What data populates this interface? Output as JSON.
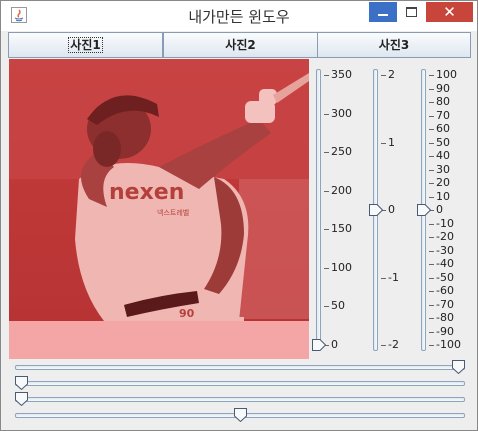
{
  "window": {
    "title": "내가만든 윈도우",
    "close_glyph": "✕"
  },
  "tabs": [
    {
      "label": "사진1",
      "selected": true
    },
    {
      "label": "사진2",
      "selected": false
    },
    {
      "label": "사진3",
      "selected": false
    }
  ],
  "photo": {
    "description": "batter mid-swing photo with red tint",
    "jersey_text": "nexen",
    "jersey_subtext": "넥스트레벨",
    "number": "90",
    "tint_color": "#e85a5a"
  },
  "sliders": {
    "vertical": [
      {
        "name": "zoom-slider",
        "min": 0,
        "max": 350,
        "value": 0,
        "labels": [
          "350",
          "300",
          "250",
          "200",
          "150",
          "100",
          "50",
          "0"
        ]
      },
      {
        "name": "offset-slider",
        "min": -2,
        "max": 2,
        "value": 0,
        "labels": [
          "2",
          "1",
          "0",
          "-1",
          "-2"
        ]
      },
      {
        "name": "percent-slider",
        "min": -100,
        "max": 100,
        "value": 0,
        "labels": [
          "100",
          "90",
          "80",
          "70",
          "60",
          "50",
          "40",
          "30",
          "20",
          "10",
          "0",
          "-10",
          "-20",
          "-30",
          "-40",
          "-50",
          "-60",
          "-70",
          "-80",
          "-90",
          "-100"
        ]
      }
    ],
    "horizontal": [
      {
        "name": "horizontal-slider-1",
        "value": 1.0
      },
      {
        "name": "horizontal-slider-2",
        "value": 0.0
      },
      {
        "name": "horizontal-slider-3",
        "value": 0.0
      },
      {
        "name": "horizontal-slider-4",
        "value": 0.5
      }
    ]
  },
  "colors": {
    "accent": "#3c6fc6",
    "close": "#c7453b",
    "tint": "#e85a5a"
  }
}
